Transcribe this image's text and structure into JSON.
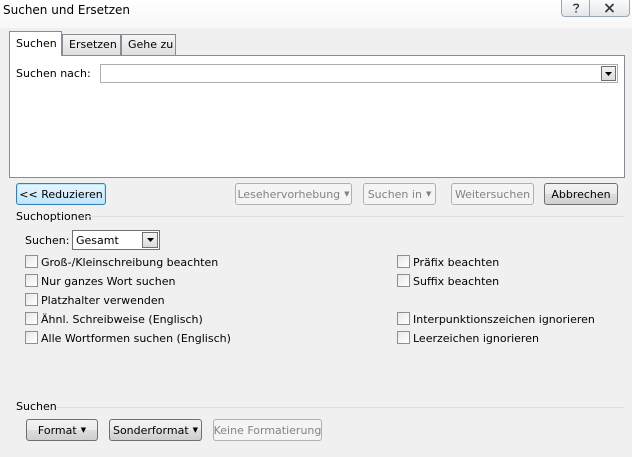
{
  "window": {
    "title": "Suchen und Ersetzen",
    "help_icon": "help-icon",
    "close_icon": "close-icon"
  },
  "tabs": [
    {
      "label": "Suchen",
      "active": true
    },
    {
      "label": "Ersetzen",
      "active": false
    },
    {
      "label": "Gehe zu",
      "active": false
    }
  ],
  "search": {
    "label": "Suchen nach:",
    "value": ""
  },
  "buttons": {
    "reduce": "<< Reduzieren",
    "reading_highlight": "Lesehervorhebung",
    "find_in": "Suchen in",
    "find_next": "Weitersuchen",
    "cancel": "Abbrechen"
  },
  "options": {
    "section_title": "Suchoptionen",
    "search_label": "Suchen:",
    "search_direction": "Gesamt",
    "left": [
      {
        "label": "Groß-/Kleinschreibung beachten",
        "checked": false
      },
      {
        "label": "Nur ganzes Wort suchen",
        "checked": false
      },
      {
        "label": "Platzhalter verwenden",
        "checked": false
      },
      {
        "label": "Ähnl. Schreibweise (Englisch)",
        "checked": false
      },
      {
        "label": "Alle Wortformen suchen (Englisch)",
        "checked": false
      }
    ],
    "right": [
      {
        "label": "Präfix beachten",
        "checked": false
      },
      {
        "label": "Suffix beachten",
        "checked": false
      },
      {
        "label": "Interpunktionszeichen ignorieren",
        "checked": false
      },
      {
        "label": "Leerzeichen ignorieren",
        "checked": false
      }
    ]
  },
  "bottom": {
    "section_title": "Suchen",
    "format": "Format",
    "special": "Sonderformat",
    "no_format": "Keine Formatierung"
  }
}
